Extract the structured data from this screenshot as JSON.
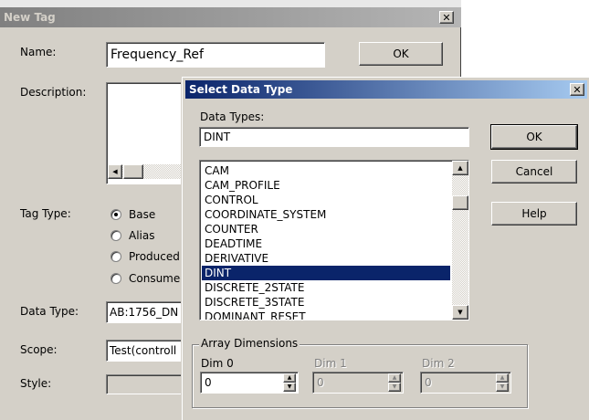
{
  "new_tag": {
    "title": "New Tag",
    "name_label": "Name:",
    "name_value": "Frequency_Ref",
    "ok_label": "OK",
    "description_label": "Description:",
    "tag_type_label": "Tag Type:",
    "tag_types": [
      "Base",
      "Alias",
      "Produced",
      "Consumed"
    ],
    "data_type_label": "Data Type:",
    "data_type_value": "AB:1756_DN",
    "scope_label": "Scope:",
    "scope_value": "Test(controll",
    "style_label": "Style:"
  },
  "select_data_type": {
    "title": "Select Data Type",
    "data_types_label": "Data Types:",
    "data_types_value": "DINT",
    "ok_label": "OK",
    "cancel_label": "Cancel",
    "help_label": "Help",
    "list_items": [
      "CAM",
      "CAM_PROFILE",
      "CONTROL",
      "COORDINATE_SYSTEM",
      "COUNTER",
      "DEADTIME",
      "DERIVATIVE",
      "DINT",
      "DISCRETE_2STATE",
      "DISCRETE_3STATE",
      "DOMINANT_RESET"
    ],
    "selected_item": "DINT",
    "array_dimensions_label": "Array Dimensions",
    "dim0_label": "Dim 0",
    "dim0_value": "0",
    "dim1_label": "Dim 1",
    "dim1_value": "0",
    "dim2_label": "Dim 2",
    "dim2_value": "0"
  }
}
